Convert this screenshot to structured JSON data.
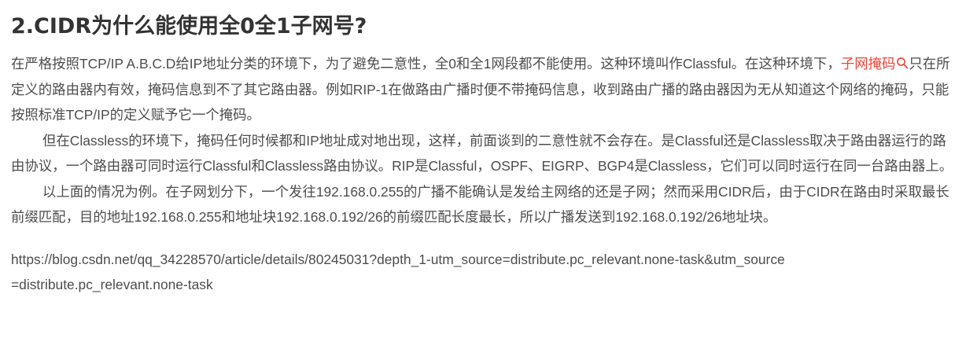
{
  "heading": "2.CIDR为什么能使用全0全1子网号?",
  "para1": {
    "before": "在严格按照TCP/IP A.B.C.D给IP地址分类的环境下，为了避免二意性，全0和全1网段都不能使用。这种环境叫作Classful。在这种环境下，",
    "link_text": "子网掩码",
    "link_icon": "search-icon",
    "after": "只在所定义的路由器内有效，掩码信息到不了其它路由器。例如RIP-1在做路由广播时便不带掩码信息，收到路由广播的路由器因为无从知道这个网络的掩码，只能按照标准TCP/IP的定义赋予它一个掩码。"
  },
  "para2": "但在Classless的环境下，掩码任何时候都和IP地址成对地出现，这样，前面谈到的二意性就不会存在。是Classful还是Classless取决于路由器运行的路由协议，一个路由器可同时运行Classful和Classless路由协议。RIP是Classful，OSPF、EIGRP、BGP4是Classless，它们可以同时运行在同一台路由器上。",
  "para3": "以上面的情况为例。在子网划分下，一个发往192.168.0.255的广播不能确认是发给主网络的还是子网；然而采用CIDR后，由于CIDR在路由时采取最长前缀匹配，目的地址192.168.0.255和地址块192.168.0.192/26的前缀匹配长度最长，所以广播发送到192.168.0.192/26地址块。",
  "source_url": "https://blog.csdn.net/qq_34228570/article/details/80245031?depth_1-utm_source=distribute.pc_relevant.none-task&utm_source=distribute.pc_relevant.none-task",
  "colors": {
    "text": "#4d4d4d",
    "heading": "#333333",
    "link": "#f44236"
  }
}
